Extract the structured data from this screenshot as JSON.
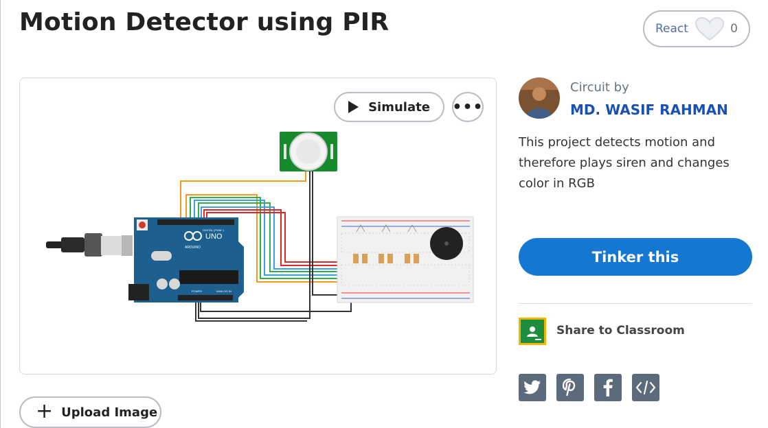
{
  "project": {
    "title": "Motion Detector using PIR",
    "react_label": "React",
    "react_count": "0"
  },
  "viewer": {
    "simulate_label": "Simulate",
    "more_label": "•••"
  },
  "upload": {
    "label": "Upload Image"
  },
  "author": {
    "circuit_by": "Circuit by",
    "name": "MD. WASIF RAHMAN"
  },
  "description": "This project detects motion and therefore plays siren and changes color in RGB",
  "actions": {
    "tinker_label": "Tinker this",
    "share_classroom_label": "Share to Classroom"
  },
  "circuit_labels": {
    "board": "UNO",
    "brand": "ARDUINO",
    "digital": "DIGITAL (PWM~)",
    "power": "POWER",
    "analog": "ANALOG IN"
  },
  "colors": {
    "accent": "#1477d2",
    "author_link": "#1a4fb4",
    "social_bg": "#5b6b7c",
    "classroom": "#1e8e3e"
  },
  "social_icons": [
    "twitter-icon",
    "pinterest-icon",
    "facebook-icon",
    "embed-code-icon"
  ]
}
